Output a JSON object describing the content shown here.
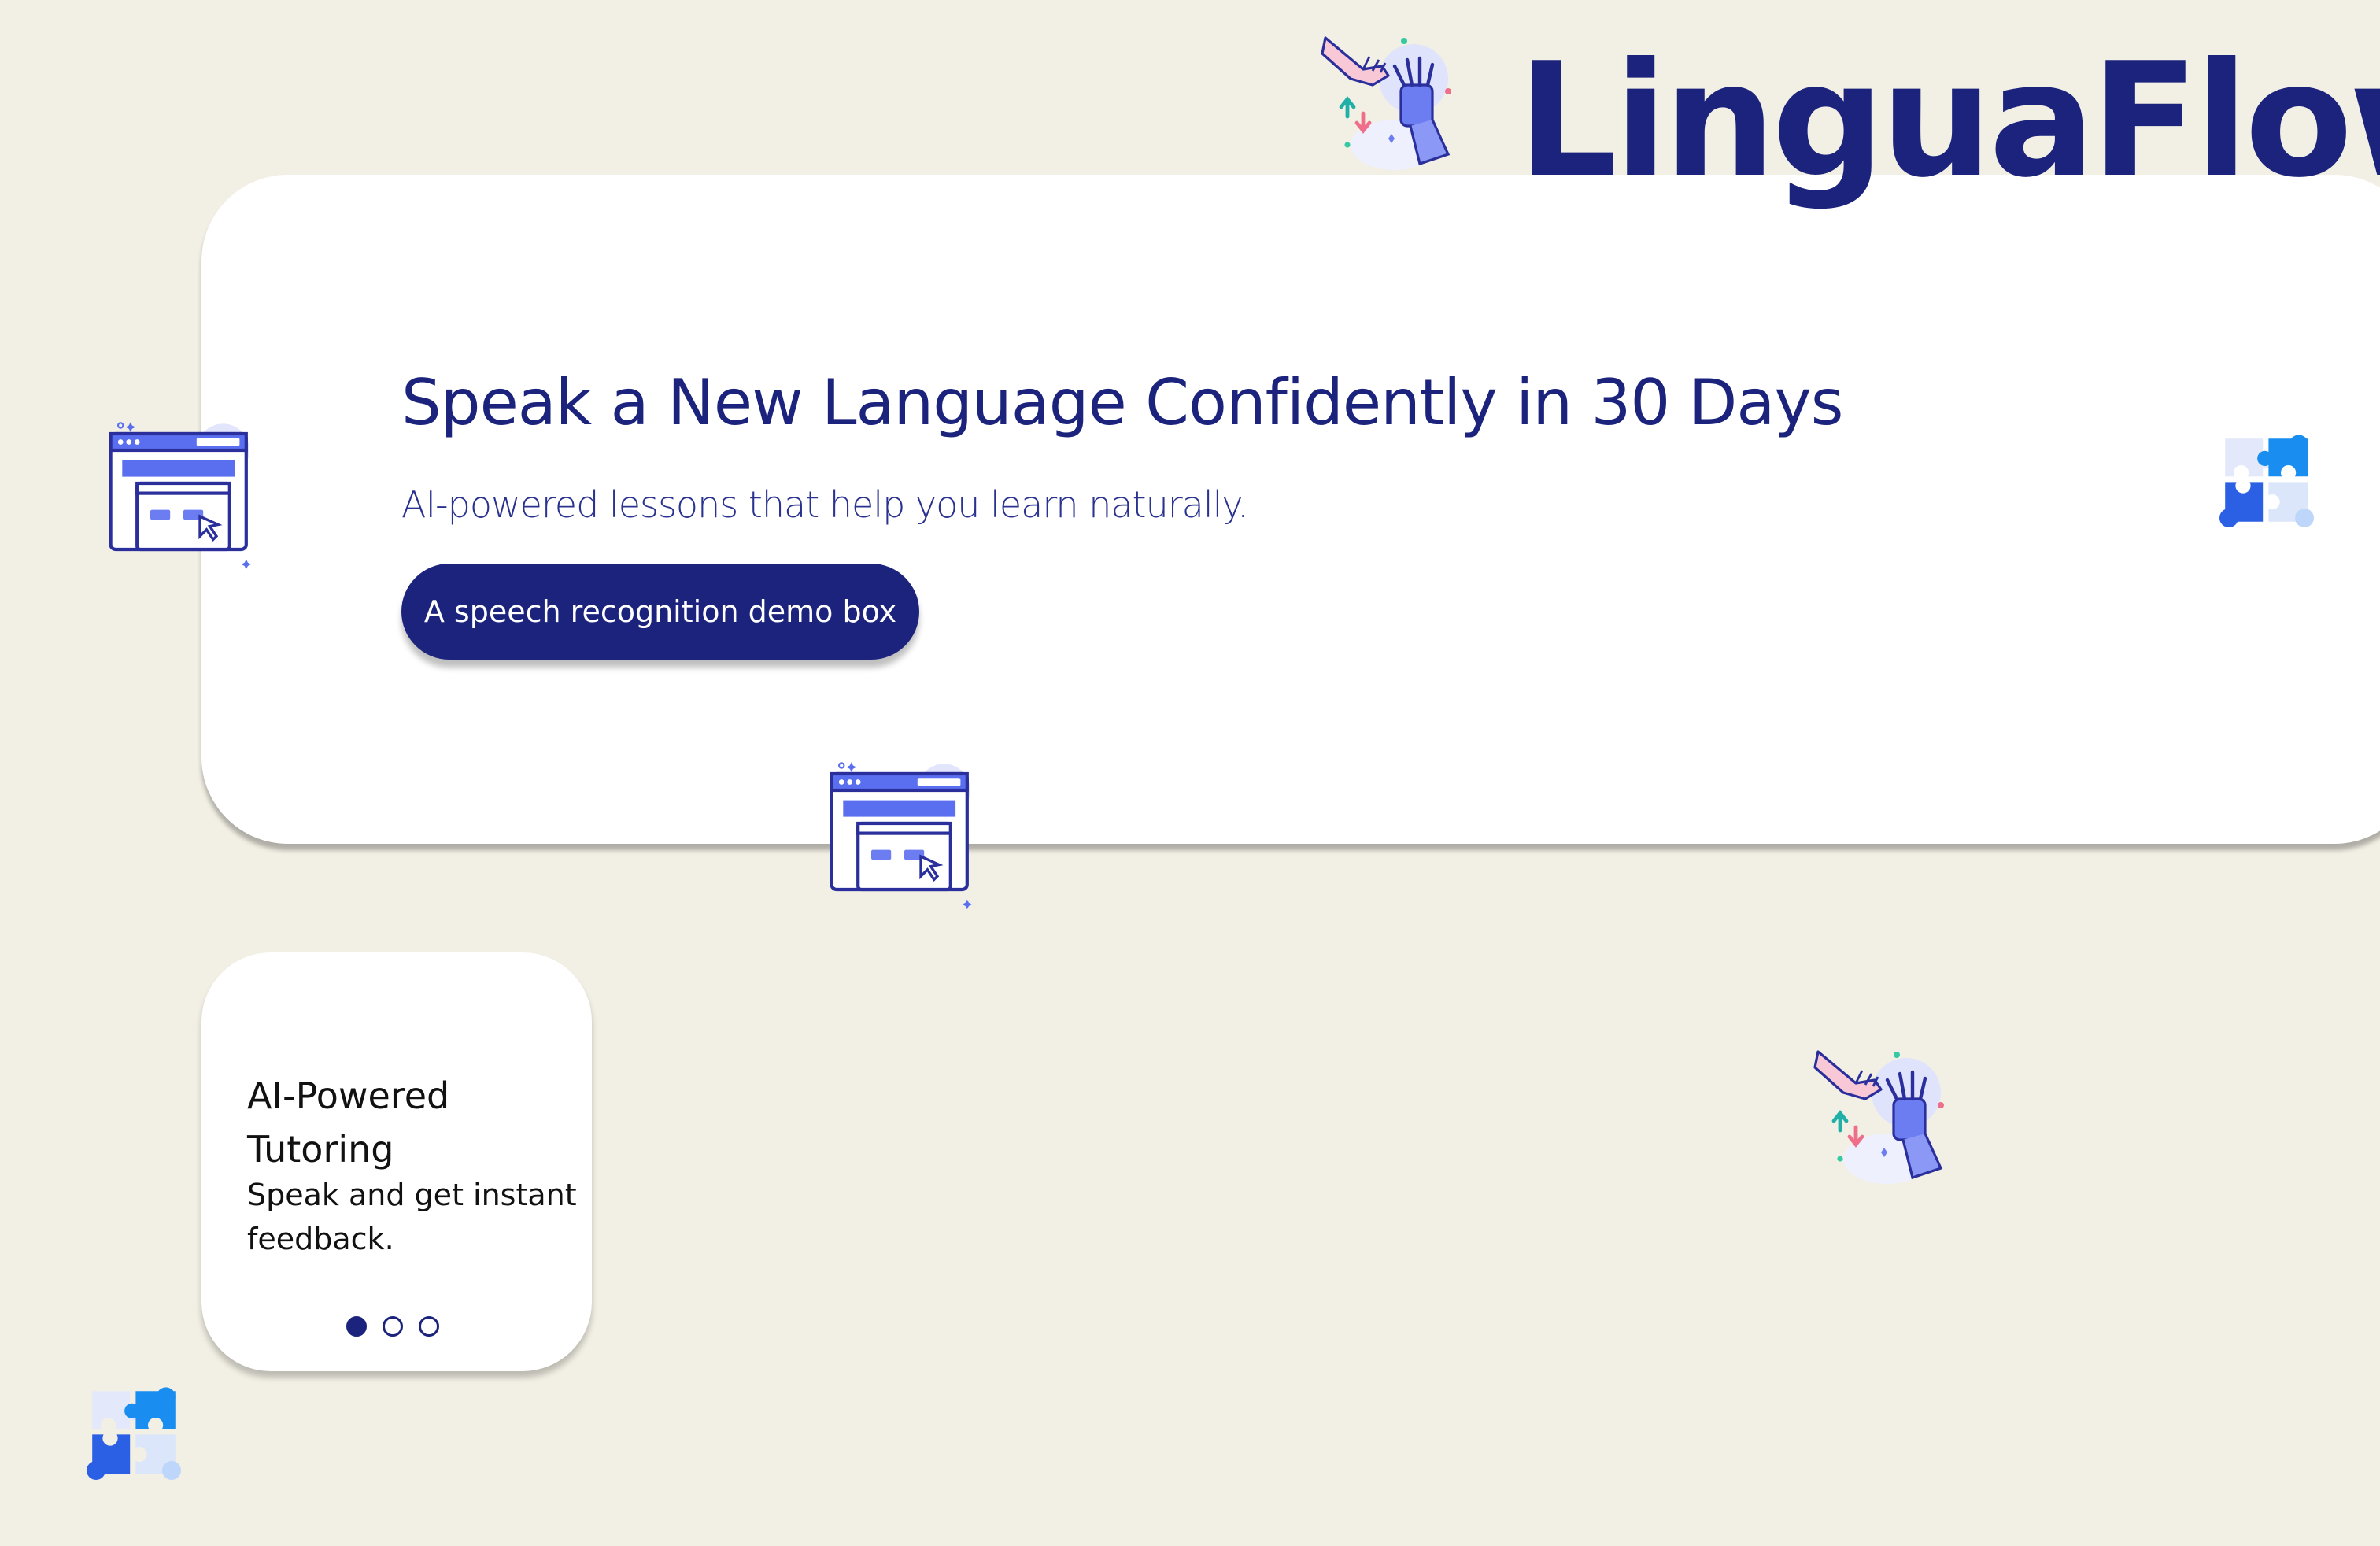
{
  "brand": {
    "name": "LinguaFlow"
  },
  "hero": {
    "title": "Speak a New Language Confidently in 30 Days",
    "subtitle": "AI-powered lessons that help you learn naturally.",
    "button_label": "A speech recognition demo box"
  },
  "feature_card": {
    "title": "AI-Powered Tutoring",
    "description": "Speak and get instant feedback."
  },
  "carousel": {
    "current_slide": 1,
    "total_slides": 3
  },
  "colors": {
    "background": "#f2efe4",
    "brand_navy": "#1b237d",
    "card": "#ffffff"
  },
  "icons": [
    "human-robot-hand-icon",
    "browser-window-icon",
    "puzzle-icon"
  ]
}
